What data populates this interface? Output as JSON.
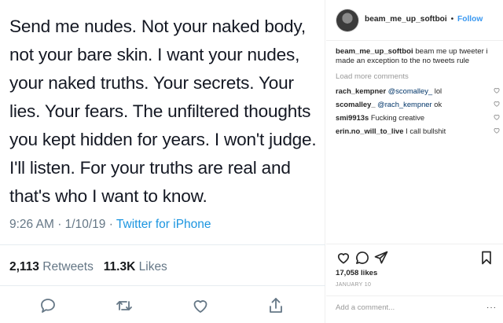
{
  "tweet": {
    "text_lines": [
      "Send me nudes. Not your naked body,",
      "not your bare skin. I want your nudes,",
      "your naked truths. Your secrets. Your",
      "lies. Your fears. The unfiltered thoughts",
      "you kept hidden for years. I won't judge.",
      "I'll listen. For your truths are real and",
      "that's who I want to know."
    ],
    "time": "9:26 AM",
    "date": "1/10/19",
    "separator": "·",
    "source": "Twitter for iPhone",
    "retweets_count": "2,113",
    "retweets_label": "Retweets",
    "likes_count": "11.3K",
    "likes_label": "Likes",
    "icons": [
      "reply-icon",
      "retweet-icon",
      "like-icon",
      "share-icon"
    ]
  },
  "post": {
    "username": "beam_me_up_softboi",
    "separator": "•",
    "follow_label": "Follow",
    "caption_user": "beam_me_up_softboi",
    "caption_text": "beam me up tweeter i made an exception to the no tweets rule",
    "load_more": "Load more comments",
    "comments": [
      {
        "user": "rach_kempner",
        "mention": "@scomalley_",
        "text": "lol"
      },
      {
        "user": "scomalley_",
        "mention": "@rach_kempner",
        "text": "ok"
      },
      {
        "user": "smi9913s",
        "mention": "",
        "text": "Fucking creative"
      },
      {
        "user": "erin.no_will_to_live",
        "mention": "",
        "text": "I call bullshit"
      }
    ],
    "likes": "17,058 likes",
    "date": "JANUARY 10",
    "add_comment_placeholder": "Add a comment...",
    "options": "···",
    "icons": [
      "heart-icon",
      "comment-icon",
      "share-icon",
      "bookmark-icon"
    ]
  },
  "colors": {
    "link_blue": "#1b95e0",
    "follow_blue": "#3897f0",
    "muted_gray": "#657786",
    "ig_gray": "#999999"
  }
}
